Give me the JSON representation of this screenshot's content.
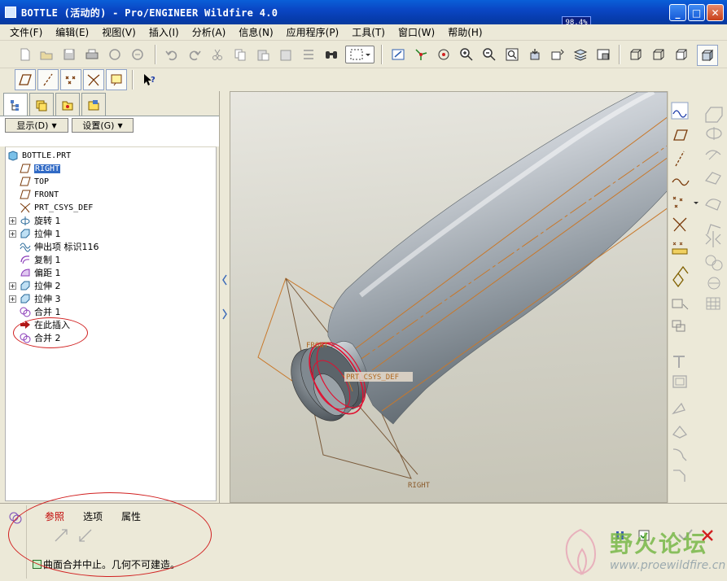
{
  "window": {
    "title": "BOTTLE (活动的) - Pro/ENGINEER Wildfire 4.0",
    "buttons": [
      "minimize",
      "maximize",
      "close"
    ]
  },
  "memory_meter": {
    "text": "98.4%",
    "level_percent": 98.4
  },
  "menu": [
    "文件(F)",
    "编辑(E)",
    "视图(V)",
    "插入(I)",
    "分析(A)",
    "信息(N)",
    "应用程序(P)",
    "工具(T)",
    "窗口(W)",
    "帮助(H)"
  ],
  "left_panel": {
    "tabs": [
      "model-tree-tab",
      "layers-tab",
      "favorites-tab",
      "folder-tab"
    ],
    "show_dropdown": "显示(D)",
    "settings_dropdown": "设置(G)",
    "tree": [
      {
        "label": "BOTTLE.PRT",
        "icon": "part-icon",
        "expand": false,
        "selected": false
      },
      {
        "label": "RIGHT",
        "icon": "datum-plane-icon",
        "expand": false,
        "selected": true
      },
      {
        "label": "TOP",
        "icon": "datum-plane-icon",
        "expand": false,
        "selected": false
      },
      {
        "label": "FRONT",
        "icon": "datum-plane-icon",
        "expand": false,
        "selected": false
      },
      {
        "label": "PRT_CSYS_DEF",
        "icon": "csys-icon",
        "expand": false,
        "selected": false
      },
      {
        "label": "旋转 1",
        "icon": "revolve-icon",
        "expand": true,
        "selected": false
      },
      {
        "label": "拉伸 1",
        "icon": "extrude-icon",
        "expand": true,
        "selected": false
      },
      {
        "label": "伸出项 标识116",
        "icon": "protrusion-icon",
        "expand": false,
        "selected": false
      },
      {
        "label": "复制 1",
        "icon": "copy-icon",
        "expand": false,
        "selected": false
      },
      {
        "label": "偏距 1",
        "icon": "offset-icon",
        "expand": false,
        "selected": false
      },
      {
        "label": "拉伸 2",
        "icon": "extrude-icon",
        "expand": true,
        "selected": false
      },
      {
        "label": "拉伸 3",
        "icon": "extrude-icon",
        "expand": true,
        "selected": false
      },
      {
        "label": "合并 1",
        "icon": "merge-icon",
        "expand": false,
        "selected": false
      },
      {
        "label": "在此插入",
        "icon": "insert-here-icon",
        "expand": false,
        "selected": false
      },
      {
        "label": "合并 2",
        "icon": "merge-icon",
        "expand": false,
        "selected": false
      }
    ]
  },
  "graphics": {
    "datum_labels": {
      "front": "FRONT",
      "csys": "PRT_CSYS_DEF",
      "right": "RIGHT"
    }
  },
  "dashboard": {
    "tabs": [
      "参照",
      "选项",
      "属性"
    ],
    "active_tab": "参照",
    "message": "曲面合并中止。几何不可建造。"
  },
  "watermark": {
    "cn": "野火论坛",
    "url": "www.proewildfire.cn"
  },
  "colors": {
    "titlebar": "#0a46c4",
    "selection": "#316ac5",
    "annotation_red": "#d12020",
    "datum_orange": "#c8782a",
    "active_tab_red": "#c00000"
  }
}
